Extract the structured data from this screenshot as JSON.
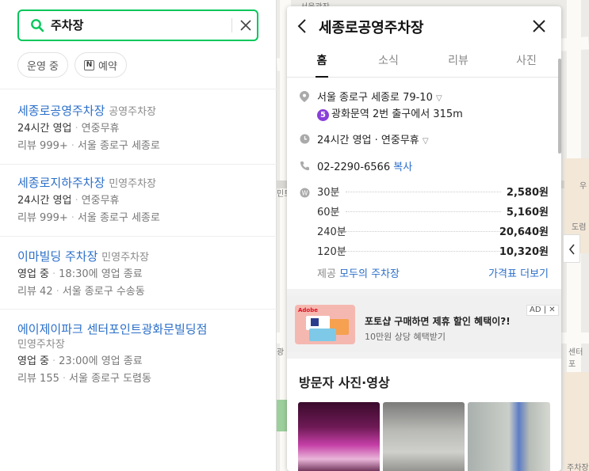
{
  "search": {
    "query": "주차장",
    "placeholder": ""
  },
  "filters": [
    {
      "label": "운영 중"
    },
    {
      "icon_letter": "N",
      "label": "예약"
    }
  ],
  "results": [
    {
      "name": "세종로공영주차장",
      "category": "공영주차장",
      "status": "24시간 영업",
      "status_extra": "연중무휴",
      "review": "리뷰 999+",
      "address": "서울 종로구 세종로"
    },
    {
      "name": "세종로지하주차장",
      "category": "민영주차장",
      "status": "24시간 영업",
      "status_extra": "연중무휴",
      "review": "리뷰 999+",
      "address": "서울 종로구 세종로"
    },
    {
      "name": "이마빌딩 주차장",
      "category": "민영주차장",
      "status": "영업 중",
      "status_extra": "18:30에 영업 종료",
      "review": "리뷰 42",
      "address": "서울 종로구 수송동"
    },
    {
      "name": "에이제이파크 센터포인트광화문빌딩점",
      "category": "민영주차장",
      "status": "영업 중",
      "status_extra": "23:00에 영업 종료",
      "review": "리뷰 155",
      "address": "서울 종로구 도렴동"
    }
  ],
  "detail": {
    "title": "세종로공영주차장",
    "tabs": [
      "홈",
      "소식",
      "리뷰",
      "사진"
    ],
    "address": "서울 종로구 세종로 79-10",
    "subway_line": "5",
    "subway": "광화문역 2번 출구에서 315m",
    "hours": "24시간 영업 · 연중무휴",
    "phone": "02-2290-6566",
    "copy_label": "복사",
    "prices": [
      {
        "duration": "30분",
        "price": "2,580원"
      },
      {
        "duration": "60분",
        "price": "5,160원"
      },
      {
        "duration": "240분",
        "price": "20,640원"
      },
      {
        "duration": "120분",
        "price": "10,320원"
      }
    ],
    "provider_prefix": "제공",
    "provider_name": "모두의 주차장",
    "more_prices": "가격표 더보기",
    "ad": {
      "badge": "AD | ✕",
      "headline": "포토샵 구매하면 제휴 할인 혜택이?!",
      "subline": "10만원 상당 혜택받기",
      "thumb_brand": "Adobe"
    },
    "photos_title": "방문자 사진·영상"
  },
  "map_labels": [
    "서울광장",
    "우",
    "도렴",
    "센터포",
    "민트",
    "광",
    "주차장"
  ],
  "colors": {
    "accent_green": "#03c75a",
    "link_blue": "#2b6fc9",
    "subway_line5": "#8a3fd8"
  }
}
